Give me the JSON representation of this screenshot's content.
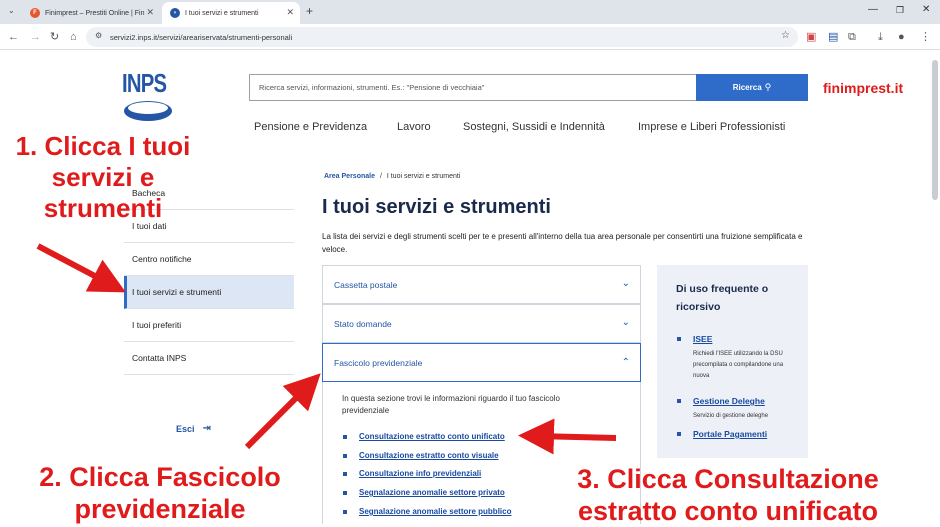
{
  "browser": {
    "tabs": [
      {
        "title": "Finimprest – Prestiti Online | Fin"
      },
      {
        "title": "I tuoi servizi e strumenti"
      }
    ],
    "url": "servizi2.inps.it/servizi/areariservata/strumenti-personali"
  },
  "header": {
    "logo": "INPS",
    "search_placeholder": "Ricerca servizi, informazioni, strumenti. Es.: \"Pensione di vecchiaia\"",
    "search_button": "Ricerca",
    "watermark": "finimprest.it",
    "nav": [
      "Pensione e Previdenza",
      "Lavoro",
      "Sostegni, Sussidi e Indennità",
      "Imprese e Liberi Professionisti"
    ]
  },
  "sidebar": {
    "items": [
      "Bacheca",
      "I tuoi dati",
      "Centro notifiche",
      "I tuoi servizi e strumenti",
      "I tuoi preferiti",
      "Contatta INPS"
    ],
    "logout": "Esci"
  },
  "main": {
    "breadcrumb_root": "Area Personale",
    "breadcrumb_sep": "/",
    "breadcrumb_current": "I tuoi servizi e strumenti",
    "title": "I tuoi servizi e strumenti",
    "description": "La lista dei servizi e degli strumenti scelti per te e presenti all'interno della tua area personale per consentirti una fruizione semplificata e veloce.",
    "accordions": [
      "Cassetta postale",
      "Stato domande",
      "Fascicolo previdenziale"
    ],
    "panel_intro": "In questa sezione trovi le informazioni riguardo il tuo fascicolo previdenziale",
    "links": [
      "Consultazione estratto conto unificato",
      "Consultazione estratto conto visuale",
      "Consultazione info previdenziali",
      "Segnalazione anomalie settore privato",
      "Segnalazione anomalie settore pubblico"
    ]
  },
  "frequent": {
    "title": "Di uso frequente o ricorsivo",
    "items": [
      {
        "label": "ISEE",
        "desc": "Richiedi l'ISEE utilizzando la DSU precompilata o compilandone una nuova"
      },
      {
        "label": "Gestione Deleghe",
        "desc": "Servizio di gestione deleghe"
      },
      {
        "label": "Portale Pagamenti",
        "desc": ""
      }
    ]
  },
  "annotations": {
    "step1": "1. Clicca I tuoi servizi e strumenti",
    "step2": "2. Clicca Fascicolo previdenziale",
    "step3": "3. Clicca Consultazione estratto conto unificato",
    "color": "#e01b1b"
  }
}
